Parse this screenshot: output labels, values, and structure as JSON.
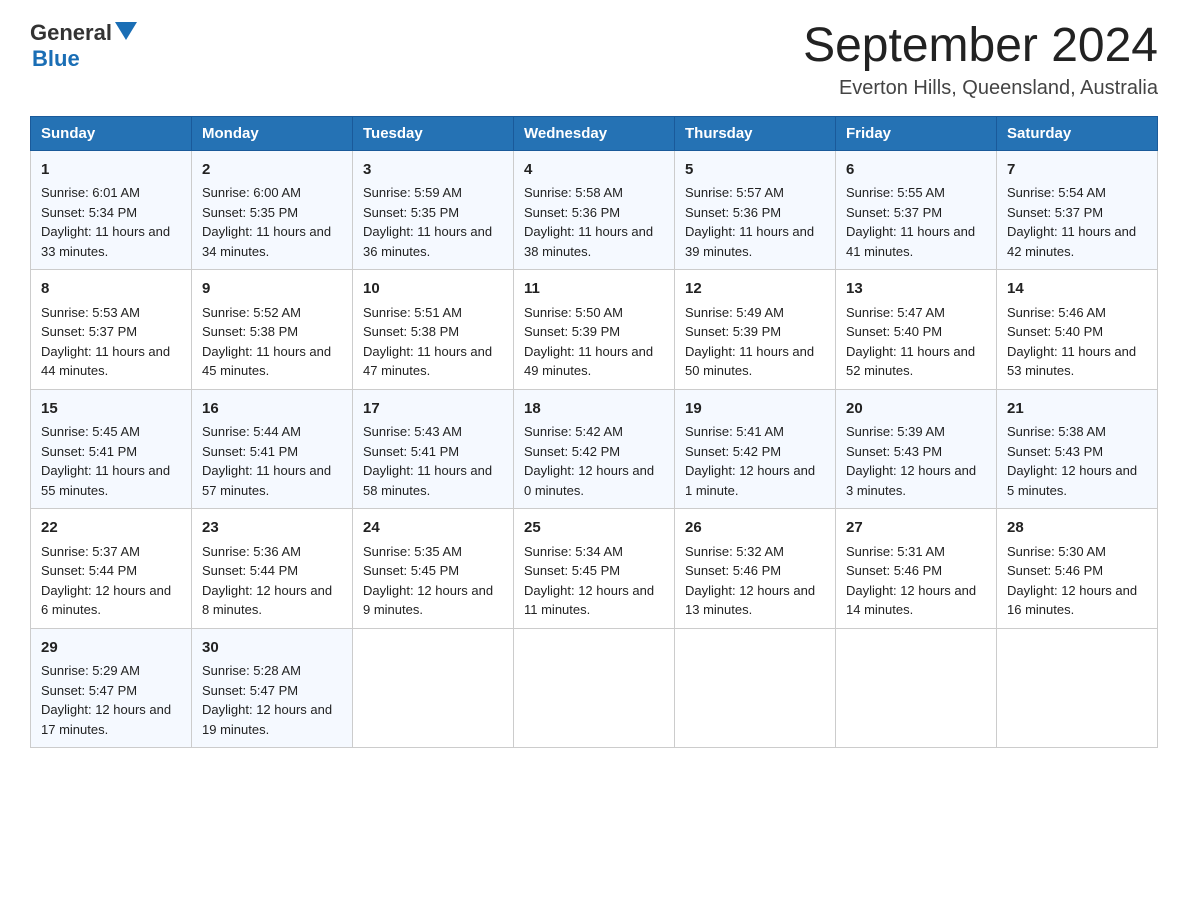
{
  "header": {
    "logo_general": "General",
    "logo_blue": "Blue",
    "main_title": "September 2024",
    "subtitle": "Everton Hills, Queensland, Australia"
  },
  "days_of_week": [
    "Sunday",
    "Monday",
    "Tuesday",
    "Wednesday",
    "Thursday",
    "Friday",
    "Saturday"
  ],
  "weeks": [
    [
      {
        "day": "1",
        "sunrise": "6:01 AM",
        "sunset": "5:34 PM",
        "daylight": "11 hours and 33 minutes."
      },
      {
        "day": "2",
        "sunrise": "6:00 AM",
        "sunset": "5:35 PM",
        "daylight": "11 hours and 34 minutes."
      },
      {
        "day": "3",
        "sunrise": "5:59 AM",
        "sunset": "5:35 PM",
        "daylight": "11 hours and 36 minutes."
      },
      {
        "day": "4",
        "sunrise": "5:58 AM",
        "sunset": "5:36 PM",
        "daylight": "11 hours and 38 minutes."
      },
      {
        "day": "5",
        "sunrise": "5:57 AM",
        "sunset": "5:36 PM",
        "daylight": "11 hours and 39 minutes."
      },
      {
        "day": "6",
        "sunrise": "5:55 AM",
        "sunset": "5:37 PM",
        "daylight": "11 hours and 41 minutes."
      },
      {
        "day": "7",
        "sunrise": "5:54 AM",
        "sunset": "5:37 PM",
        "daylight": "11 hours and 42 minutes."
      }
    ],
    [
      {
        "day": "8",
        "sunrise": "5:53 AM",
        "sunset": "5:37 PM",
        "daylight": "11 hours and 44 minutes."
      },
      {
        "day": "9",
        "sunrise": "5:52 AM",
        "sunset": "5:38 PM",
        "daylight": "11 hours and 45 minutes."
      },
      {
        "day": "10",
        "sunrise": "5:51 AM",
        "sunset": "5:38 PM",
        "daylight": "11 hours and 47 minutes."
      },
      {
        "day": "11",
        "sunrise": "5:50 AM",
        "sunset": "5:39 PM",
        "daylight": "11 hours and 49 minutes."
      },
      {
        "day": "12",
        "sunrise": "5:49 AM",
        "sunset": "5:39 PM",
        "daylight": "11 hours and 50 minutes."
      },
      {
        "day": "13",
        "sunrise": "5:47 AM",
        "sunset": "5:40 PM",
        "daylight": "11 hours and 52 minutes."
      },
      {
        "day": "14",
        "sunrise": "5:46 AM",
        "sunset": "5:40 PM",
        "daylight": "11 hours and 53 minutes."
      }
    ],
    [
      {
        "day": "15",
        "sunrise": "5:45 AM",
        "sunset": "5:41 PM",
        "daylight": "11 hours and 55 minutes."
      },
      {
        "day": "16",
        "sunrise": "5:44 AM",
        "sunset": "5:41 PM",
        "daylight": "11 hours and 57 minutes."
      },
      {
        "day": "17",
        "sunrise": "5:43 AM",
        "sunset": "5:41 PM",
        "daylight": "11 hours and 58 minutes."
      },
      {
        "day": "18",
        "sunrise": "5:42 AM",
        "sunset": "5:42 PM",
        "daylight": "12 hours and 0 minutes."
      },
      {
        "day": "19",
        "sunrise": "5:41 AM",
        "sunset": "5:42 PM",
        "daylight": "12 hours and 1 minute."
      },
      {
        "day": "20",
        "sunrise": "5:39 AM",
        "sunset": "5:43 PM",
        "daylight": "12 hours and 3 minutes."
      },
      {
        "day": "21",
        "sunrise": "5:38 AM",
        "sunset": "5:43 PM",
        "daylight": "12 hours and 5 minutes."
      }
    ],
    [
      {
        "day": "22",
        "sunrise": "5:37 AM",
        "sunset": "5:44 PM",
        "daylight": "12 hours and 6 minutes."
      },
      {
        "day": "23",
        "sunrise": "5:36 AM",
        "sunset": "5:44 PM",
        "daylight": "12 hours and 8 minutes."
      },
      {
        "day": "24",
        "sunrise": "5:35 AM",
        "sunset": "5:45 PM",
        "daylight": "12 hours and 9 minutes."
      },
      {
        "day": "25",
        "sunrise": "5:34 AM",
        "sunset": "5:45 PM",
        "daylight": "12 hours and 11 minutes."
      },
      {
        "day": "26",
        "sunrise": "5:32 AM",
        "sunset": "5:46 PM",
        "daylight": "12 hours and 13 minutes."
      },
      {
        "day": "27",
        "sunrise": "5:31 AM",
        "sunset": "5:46 PM",
        "daylight": "12 hours and 14 minutes."
      },
      {
        "day": "28",
        "sunrise": "5:30 AM",
        "sunset": "5:46 PM",
        "daylight": "12 hours and 16 minutes."
      }
    ],
    [
      {
        "day": "29",
        "sunrise": "5:29 AM",
        "sunset": "5:47 PM",
        "daylight": "12 hours and 17 minutes."
      },
      {
        "day": "30",
        "sunrise": "5:28 AM",
        "sunset": "5:47 PM",
        "daylight": "12 hours and 19 minutes."
      },
      null,
      null,
      null,
      null,
      null
    ]
  ]
}
